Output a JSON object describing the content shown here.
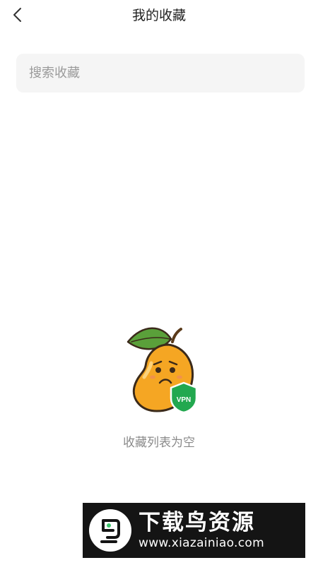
{
  "header": {
    "back_icon": "chevron-left-icon",
    "title": "我的收藏"
  },
  "search": {
    "value": "",
    "placeholder": "搜索收藏",
    "background_color": "#f5f5f5"
  },
  "empty_state": {
    "illustration": "sad-mango-vpn-illustration",
    "message": "收藏列表为空",
    "badge_text": "VPN",
    "colors": {
      "mango": "#f5a623",
      "leaf": "#5aa03a",
      "shield": "#22a84f"
    }
  },
  "watermark": {
    "title": "下载鸟资源",
    "url": "www.xiazainiao.com"
  }
}
